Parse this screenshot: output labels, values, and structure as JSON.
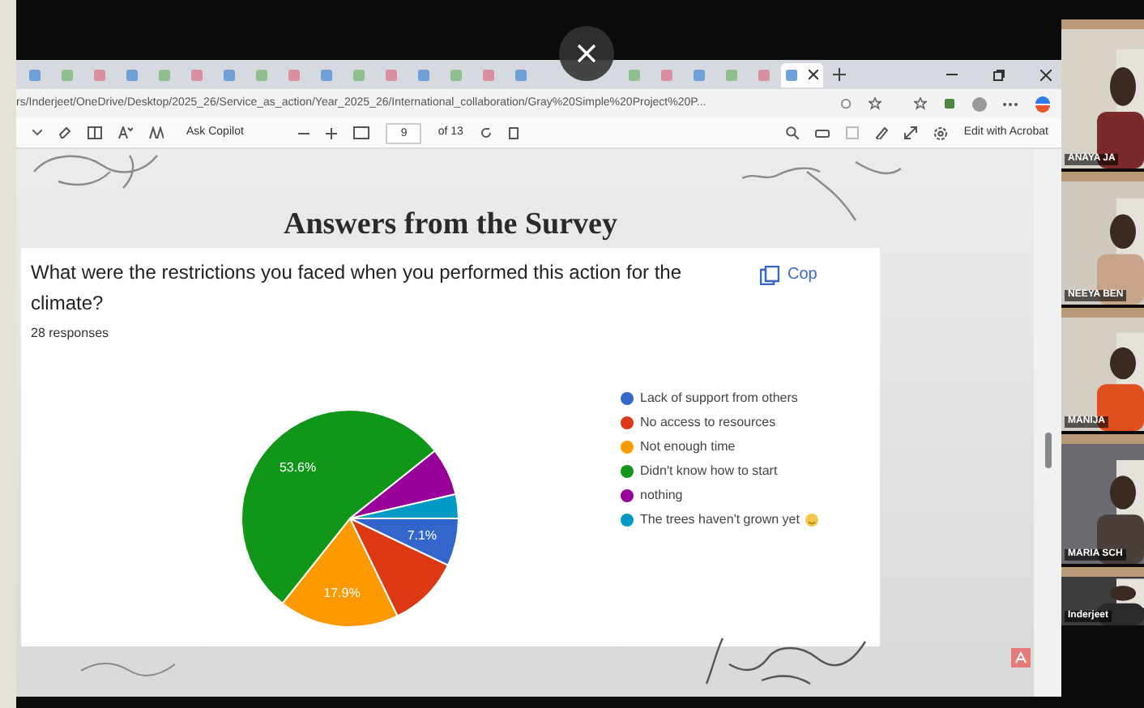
{
  "browser": {
    "tabs": [
      {
        "selected": false
      },
      {
        "selected": false
      },
      {
        "selected": false
      },
      {
        "selected": false
      },
      {
        "selected": false
      },
      {
        "selected": false
      },
      {
        "selected": false
      },
      {
        "selected": false
      },
      {
        "selected": false
      },
      {
        "selected": false
      },
      {
        "selected": false
      },
      {
        "selected": false
      },
      {
        "selected": false
      },
      {
        "selected": false
      },
      {
        "selected": false
      },
      {
        "selected": false
      },
      {
        "selected": false
      },
      {
        "selected": false
      },
      {
        "selected": false
      },
      {
        "selected": false
      },
      {
        "selected": false
      },
      {
        "selected": true
      }
    ],
    "address": "rs/Inderjeet/OneDrive/Desktop/2025_26/Service_as_action/Year_2025_26/International_collaboration/Gray%20Simple%20Project%20P...",
    "pdf_toolbar": {
      "ask": "Ask Copilot",
      "page": "9",
      "page_total": "of 13",
      "edit": "Edit with Acrobat"
    }
  },
  "slide": {
    "title": "Answers from the Survey",
    "question": "What were the restrictions you faced when you performed this action for the climate?",
    "responses": "28 responses",
    "copy": "Cop",
    "chart_data": {
      "type": "pie",
      "categories": [
        "Lack of support from others",
        "No access to resources",
        "Not enough time",
        "Didn't know how to start",
        "nothing",
        "The trees haven't grown yet"
      ],
      "values": [
        7.1,
        10.7,
        17.9,
        53.6,
        7.1,
        3.6
      ],
      "legend": "right",
      "colors": [
        "#3366cc",
        "#dc3912",
        "#ff9900",
        "#109618",
        "#990099",
        "#0099c6"
      ],
      "value_labels": [
        "7.1%",
        null,
        "17.9%",
        "53.6%",
        null,
        null
      ]
    }
  },
  "participants": [
    {
      "name": "ANAYA JA"
    },
    {
      "name": "NEEYA BEN"
    },
    {
      "name": "MANIJA"
    },
    {
      "name": "MARIA SCH"
    },
    {
      "name": "Inderjeet"
    }
  ]
}
